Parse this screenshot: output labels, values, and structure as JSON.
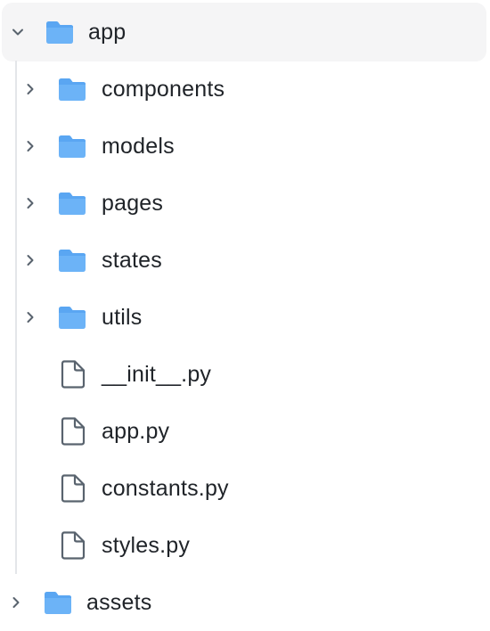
{
  "tree": {
    "root": {
      "label": "app",
      "expanded": true,
      "icon": "folder-icon",
      "chevron": "chevron-down-icon"
    },
    "children": [
      {
        "label": "components",
        "type": "folder",
        "icon": "folder-icon",
        "chevron": "chevron-right-icon"
      },
      {
        "label": "models",
        "type": "folder",
        "icon": "folder-icon",
        "chevron": "chevron-right-icon"
      },
      {
        "label": "pages",
        "type": "folder",
        "icon": "folder-icon",
        "chevron": "chevron-right-icon"
      },
      {
        "label": "states",
        "type": "folder",
        "icon": "folder-icon",
        "chevron": "chevron-right-icon"
      },
      {
        "label": "utils",
        "type": "folder",
        "icon": "folder-icon",
        "chevron": "chevron-right-icon"
      },
      {
        "label": "__init__.py",
        "type": "file",
        "icon": "file-icon"
      },
      {
        "label": "app.py",
        "type": "file",
        "icon": "file-icon"
      },
      {
        "label": "constants.py",
        "type": "file",
        "icon": "file-icon"
      },
      {
        "label": "styles.py",
        "type": "file",
        "icon": "file-icon"
      }
    ],
    "sibling": {
      "label": "assets",
      "expanded": false,
      "icon": "folder-icon",
      "chevron": "chevron-right-icon"
    }
  },
  "colors": {
    "folder": "#6cb3f7",
    "folder_tab": "#5aa6f2",
    "chevron": "#59636e",
    "file_stroke": "#59636e",
    "selected_bg": "#f5f5f6",
    "guide": "#e4e6e9",
    "text": "#1f2328"
  }
}
